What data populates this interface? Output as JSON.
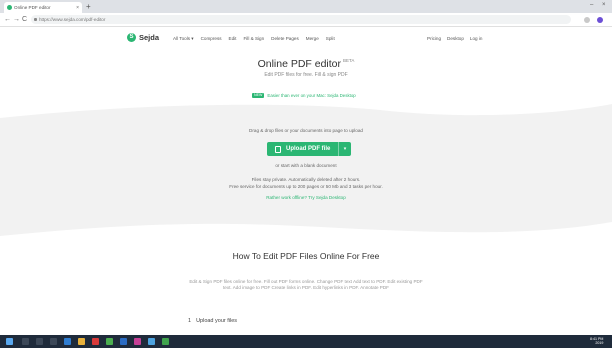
{
  "browser": {
    "tab_title": "Online PDF editor",
    "tab_close": "×",
    "new_tab": "+",
    "url": "https://www.sejda.com/pdf-editor",
    "nav_back": "←",
    "nav_forward": "→",
    "nav_reload": "C",
    "window_minimize": "–",
    "window_close": "×"
  },
  "site": {
    "logo_letter": "S",
    "logo_text": "Sejda",
    "nav": [
      "All Tools ▾",
      "Compress",
      "Edit",
      "Fill & Sign",
      "Delete Pages",
      "Merge",
      "Split"
    ],
    "nav_right": [
      "Pricing",
      "Desktop",
      "Log in"
    ]
  },
  "hero": {
    "title": "Online PDF editor",
    "beta": "BETA",
    "subtitle": "Edit PDF files for free. Fill & sign PDF",
    "promo_badge": "NEW",
    "promo_text": "Easier than ever on your Mac: Sejda Desktop"
  },
  "dropzone": {
    "instruction": "Drag & drop files or your documents into page to upload",
    "upload_label": "Upload PDF file",
    "upload_caret": "▾",
    "files_note": "or start with a blank document",
    "limits_line1": "Files stay private. Automatically deleted after 2 hours.",
    "limits_line2": "Free service for documents up to 200 pages or 50 Mb and 3 tasks per hour.",
    "offline_link": "Rather work offline? Try Sejda Desktop"
  },
  "content": {
    "section_title": "How To Edit PDF Files Online For Free",
    "section_para": "Edit & Sign PDF files online for free. Fill out PDF forms online. Change PDF text Add text to PDF. Edit existing PDF text. Add image to PDF Create links in PDF. Edit hyperlinks in PDF. Annotate PDF",
    "step_number": "1",
    "step_label": "Upload your files"
  },
  "taskbar": {
    "time": "8:41 PM",
    "date": "2019"
  },
  "colors": {
    "brand_green": "#2bb673",
    "taskbar": "#1f2b3b",
    "dropzone_grey": "#f2f2f2"
  },
  "icons": [
    "favicon-icon",
    "lock-icon",
    "back-icon",
    "forward-icon",
    "reload-icon",
    "extension-icon",
    "profile-icon",
    "file-icon",
    "windows-start-icon"
  ]
}
